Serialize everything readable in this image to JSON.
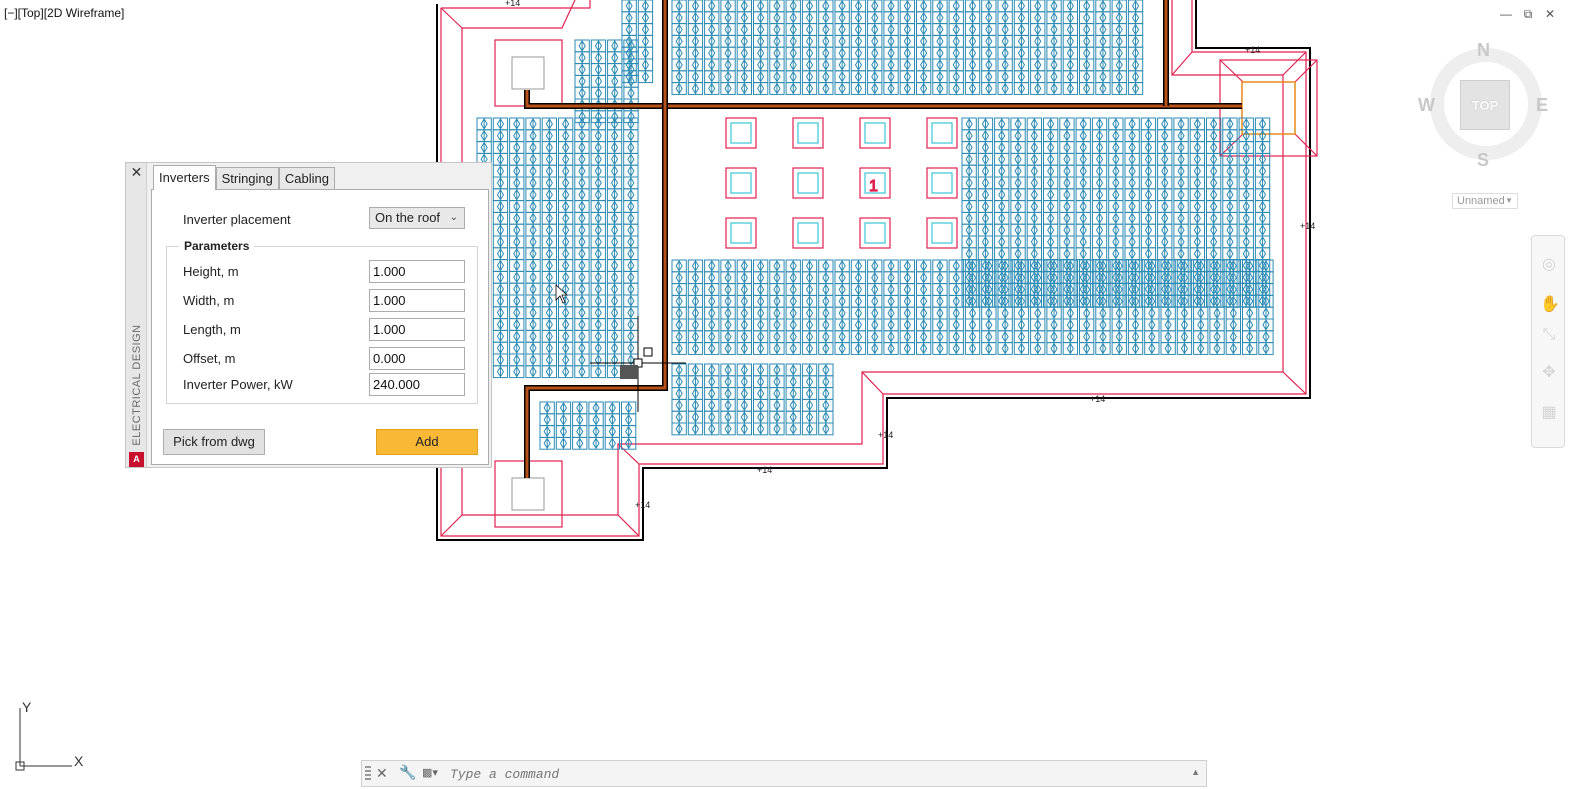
{
  "viewport": {
    "label": "[−][Top][2D Wireframe]"
  },
  "window_controls": {
    "minimize": "—",
    "restore": "⧉",
    "close": "✕"
  },
  "viewcube": {
    "north": "N",
    "south": "S",
    "east": "E",
    "west": "W",
    "face": "TOP",
    "ucs": "Unnamed"
  },
  "drawing": {
    "tags": [
      "+14",
      "+14",
      "+14",
      "+14",
      "+14",
      "+14",
      "+14"
    ],
    "zone_marker": "1",
    "colors": {
      "panel": "#2a8ab3",
      "outline": "#e0224f",
      "cable": "#8b3a12",
      "cursor": "#000000",
      "inverter": "#e88b1a"
    }
  },
  "palette": {
    "side_title": "ELECTRICAL DESIGN",
    "logo": "A",
    "close": "✕",
    "tabs": [
      "Inverters",
      "Stringing",
      "Cabling"
    ],
    "active_tab": "Inverters",
    "placement_label": "Inverter placement",
    "placement_value": "On the roof",
    "parameters_title": "Parameters",
    "fields": [
      {
        "label": "Height, m",
        "value": "1.000"
      },
      {
        "label": "Width, m",
        "value": "1.000"
      },
      {
        "label": "Length, m",
        "value": "1.000"
      },
      {
        "label": "Offset, m",
        "value": "0.000"
      },
      {
        "label": "Inverter Power, kW",
        "value": "240.000"
      }
    ],
    "pick_button": "Pick from dwg",
    "add_button": "Add"
  },
  "ucs_axes": {
    "x": "X",
    "y": "Y"
  },
  "command_line": {
    "placeholder": "Type a command"
  }
}
